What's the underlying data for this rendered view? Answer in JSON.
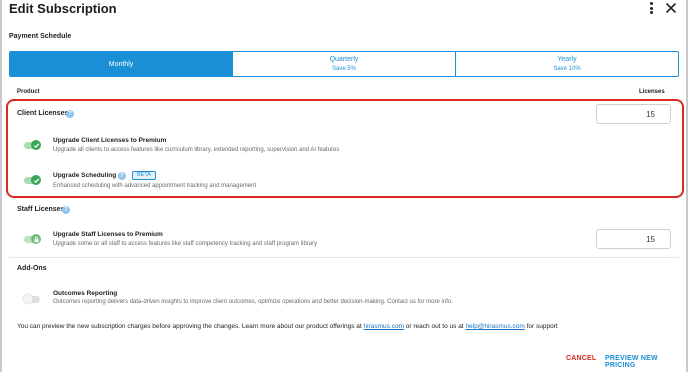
{
  "dialog": {
    "title": "Edit Subscription"
  },
  "payment_schedule": {
    "label": "Payment Schedule",
    "options": [
      {
        "label": "Monthly",
        "sub": "",
        "selected": true
      },
      {
        "label": "Quarterly",
        "sub": "Save 5%",
        "selected": false
      },
      {
        "label": "Yearly",
        "sub": "Save 10%",
        "selected": false
      }
    ]
  },
  "table_header": {
    "product": "Product",
    "licenses": "Licenses"
  },
  "client_licenses": {
    "title": "Client Licenses",
    "quantity": "15",
    "features": [
      {
        "title": "Upgrade Client Licenses to Premium",
        "description": "Upgrade all clients to access features like curriculum library, extended reporting, supervision and AI features",
        "enabled": true
      },
      {
        "title": "Upgrade Scheduling",
        "badge": "BETA",
        "description": "Enhanced scheduling with advanced appointment tracking and management",
        "enabled": true
      }
    ]
  },
  "staff_licenses": {
    "title": "Staff Licenses",
    "feature": {
      "title": "Upgrade Staff Licenses to Premium",
      "description": "Upgrade some or all staff to access features like staff competency tracking and staff program library",
      "enabled": true
    },
    "quantity": "15"
  },
  "add_ons": {
    "title": "Add-Ons",
    "feature": {
      "title": "Outcomes Reporting",
      "description": "Outcomes reporting delivers data-driven insights to improve client outcomes, optimize operations and better decision-making. Contact us for more info.",
      "enabled": false
    }
  },
  "footer": {
    "note_prefix": "You can preview the new subscription charges before approving the changes. Learn more about our product offerings at ",
    "link_site": "hirasmus.com",
    "note_middle": " or reach out to us at ",
    "link_email": "help@hirasmus.com",
    "note_suffix": " for support"
  },
  "actions": {
    "cancel": "CANCEL",
    "preview": "PREVIEW NEW PRICING"
  },
  "colors": {
    "accent": "#1a8fd6",
    "toggle_on": "#3aa757",
    "highlight": "#d92a22"
  }
}
